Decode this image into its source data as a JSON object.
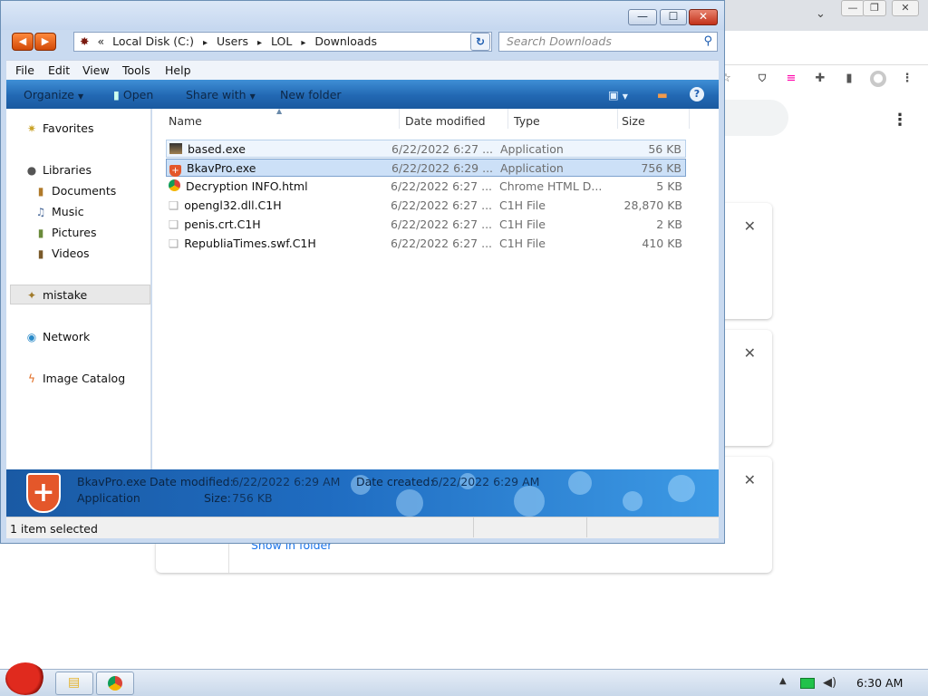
{
  "chrome": {
    "win_minimize": "⌄",
    "win_restore": "❐",
    "win_close": "✕",
    "profile_icon": "person-icon",
    "show_in_folder": "Show in folder"
  },
  "explorer": {
    "window_buttons": {
      "minimize": "—",
      "maximize": "☐",
      "close": "✕"
    },
    "address": {
      "chevron": "«",
      "segments": [
        "Local Disk (C:)",
        "Users",
        "LOL",
        "Downloads"
      ],
      "separator": "▸"
    },
    "search": {
      "placeholder": "Search Downloads"
    },
    "menu": [
      "File",
      "Edit",
      "View",
      "Tools",
      "Help"
    ],
    "commands": {
      "organize": "Organize",
      "open": "Open",
      "share": "Share with",
      "new_folder": "New folder",
      "help_icon": "?"
    },
    "nav": {
      "favorites": "Favorites",
      "libraries": "Libraries",
      "documents": "Documents",
      "music": "Music",
      "pictures": "Pictures",
      "videos": "Videos",
      "mistake": "mistake",
      "network": "Network",
      "image_catalog": "Image Catalog"
    },
    "columns": {
      "name": "Name",
      "date": "Date modified",
      "type": "Type",
      "size": "Size"
    },
    "files": [
      {
        "name": "based.exe",
        "date": "6/22/2022 6:27 ...",
        "type": "Application",
        "size": "56 KB",
        "icon": "exe-icon"
      },
      {
        "name": "BkavPro.exe",
        "date": "6/22/2022 6:29 ...",
        "type": "Application",
        "size": "756 KB",
        "icon": "bkav-shield-icon"
      },
      {
        "name": "Decryption INFO.html",
        "date": "6/22/2022 6:27 ...",
        "type": "Chrome HTML D...",
        "size": "5 KB",
        "icon": "chrome-icon"
      },
      {
        "name": "opengl32.dll.C1H",
        "date": "6/22/2022 6:27 ...",
        "type": "C1H File",
        "size": "28,870 KB",
        "icon": "file-icon"
      },
      {
        "name": "penis.crt.C1H",
        "date": "6/22/2022 6:27 ...",
        "type": "C1H File",
        "size": "2 KB",
        "icon": "file-icon"
      },
      {
        "name": "RepubliaTimes.swf.C1H",
        "date": "6/22/2022 6:27 ...",
        "type": "C1H File",
        "size": "410 KB",
        "icon": "file-icon"
      }
    ],
    "details": {
      "name": "BkavPro.exe",
      "type": "Application",
      "modified_label": "Date modified:",
      "modified_value": "6/22/2022 6:29 AM",
      "created_label": "Date created:",
      "created_value": "6/22/2022 6:29 AM",
      "size_label": "Size:",
      "size_value": "756 KB"
    },
    "status": "1 item selected"
  },
  "taskbar": {
    "clock": "6:30 AM",
    "tray_arrow": "▲"
  },
  "colors": {
    "accent": "#2268b3",
    "selection": "#cce0f7",
    "nav_orange": "#e8661a"
  }
}
